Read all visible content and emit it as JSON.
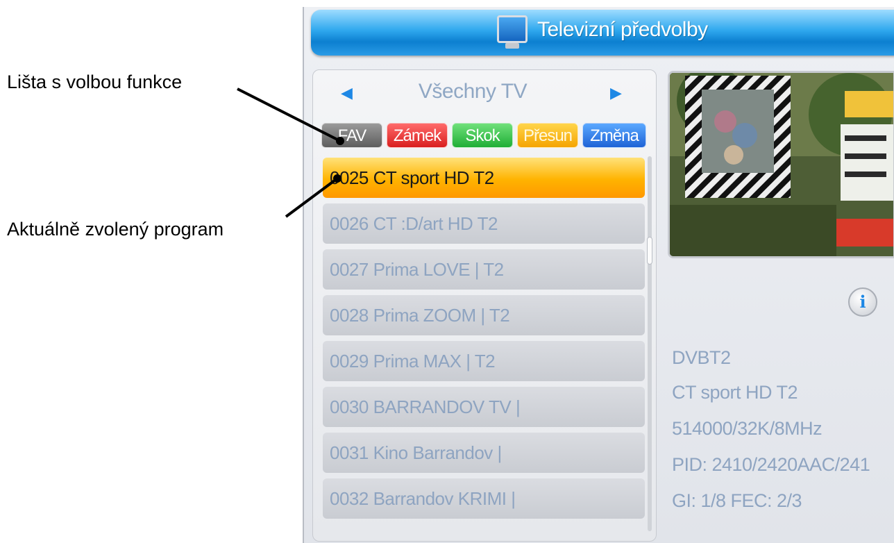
{
  "annotations": {
    "function_bar": "Lišta s volbou funkce",
    "current_program": "Aktuálně zvolený program"
  },
  "header": {
    "title": "Televizní předvolby",
    "icon": "tv-icon"
  },
  "list": {
    "group_name": "Všechny TV",
    "function_buttons": [
      {
        "label": "FAV",
        "color": "#7a7a7a"
      },
      {
        "label": "Zámek",
        "color": "#e53935"
      },
      {
        "label": "Skok",
        "color": "#2ecc40"
      },
      {
        "label": "Přesun",
        "color": "#ffb300"
      },
      {
        "label": "Změna",
        "color": "#2a78e4"
      }
    ],
    "channels": [
      {
        "label": "0025 CT sport HD T2",
        "selected": true
      },
      {
        "label": "0026 CT :D/art HD T2"
      },
      {
        "label": "0027 Prima LOVE | T2"
      },
      {
        "label": "0028 Prima ZOOM | T2"
      },
      {
        "label": "0029 Prima MAX | T2"
      },
      {
        "label": "0030 BARRANDOV TV |"
      },
      {
        "label": "0031 Kino Barrandov |"
      },
      {
        "label": "0032 Barrandov KRIMI |"
      }
    ]
  },
  "details": {
    "type": "DVBT2",
    "name": "CT sport HD T2",
    "frequency": "514000/32K/8MHz",
    "pid": "PID: 2410/2420AAC/241",
    "gi_fec": "GI: 1/8  FEC: 2/3"
  },
  "colors": {
    "accent": "#1e88e5",
    "selected_row": "#ffb300",
    "muted_text": "#8ea4c1"
  }
}
